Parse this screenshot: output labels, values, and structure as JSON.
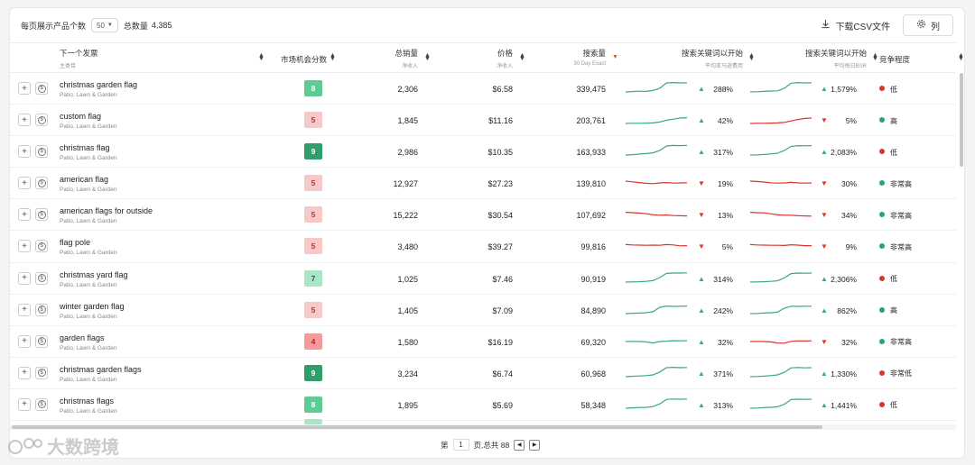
{
  "toolbar": {
    "per_page_label": "每页展示产品个数",
    "per_page_value": "50",
    "total_label": "总数量",
    "total_value": "4,385",
    "csv_label": "下载CSV文件",
    "columns_label": "列"
  },
  "columns": {
    "keyword": {
      "title": "下一个发票",
      "sub": "主类目"
    },
    "score": {
      "title": "市场机会分数"
    },
    "sales": {
      "title": "总销量",
      "sub": "净收入"
    },
    "price": {
      "title": "价格",
      "sub": "净收入"
    },
    "search": {
      "title": "搜索量",
      "sub": "30 Day Exact"
    },
    "trend1": {
      "title": "搜索关键词以开始",
      "sub": "平均亚马逊费用"
    },
    "trend2": {
      "title": "搜索关键词以开始",
      "sub": "平均每日BSR"
    },
    "competition": {
      "title": "竞争程度"
    }
  },
  "colors": {
    "up": "#3aaa78",
    "down": "#d9352b",
    "score_dark_bg": "#2f9e6b",
    "score_mid_bg": "#5ccc94",
    "score_light_bg": "#a8e6c4",
    "score_pink_bg": "#f7c8c8",
    "score_red_bg": "#f49a9a",
    "dot_red": "#d9352b",
    "dot_green": "#2ea36b"
  },
  "rows": [
    {
      "keyword": "christmas garden flag",
      "category": "Patio, Lawn & Garden",
      "score": "8",
      "score_tone": "mid",
      "sales": "2,306",
      "price": "$6.58",
      "search": "339,475",
      "t1_dir": "up",
      "t1_pct": "288%",
      "t1_spark": [
        4,
        4.2,
        4.4,
        4.3,
        4.8,
        6,
        9,
        9.2,
        9,
        9.1
      ],
      "t2_dir": "up",
      "t2_pct": "1,579%",
      "t2_spark": [
        4,
        4.1,
        4.3,
        4.5,
        4.6,
        6,
        8.8,
        9.2,
        9,
        9.1
      ],
      "competition": "低",
      "comp_color": "red"
    },
    {
      "keyword": "custom flag",
      "category": "Patio, Lawn & Garden",
      "score": "5",
      "score_tone": "pink",
      "sales": "1,845",
      "price": "$11.16",
      "search": "203,761",
      "t1_dir": "up",
      "t1_pct": "42%",
      "t1_spark": [
        4,
        4.1,
        4.1,
        4.2,
        4.3,
        4.8,
        5.8,
        6.4,
        7,
        7.2
      ],
      "t2_dir": "down",
      "t2_pct": "5%",
      "t2_spark": [
        4,
        4.1,
        4.1,
        4.2,
        4.3,
        4.6,
        5.4,
        6.2,
        6.8,
        7
      ],
      "competition": "高",
      "comp_color": "green"
    },
    {
      "keyword": "christmas flag",
      "category": "Patio, Lawn & Garden",
      "score": "9",
      "score_tone": "dark",
      "sales": "2,986",
      "price": "$10.35",
      "search": "163,933",
      "t1_dir": "up",
      "t1_pct": "317%",
      "t1_spark": [
        4,
        4.2,
        4.5,
        4.8,
        5.2,
        6.5,
        9,
        9.3,
        9.2,
        9.3
      ],
      "t2_dir": "up",
      "t2_pct": "2,083%",
      "t2_spark": [
        4,
        4.1,
        4.3,
        4.6,
        5,
        6.5,
        8.8,
        9.2,
        9.1,
        9.2
      ],
      "competition": "低",
      "comp_color": "red"
    },
    {
      "keyword": "american flag",
      "category": "Patio, Lawn & Garden",
      "score": "5",
      "score_tone": "pink",
      "sales": "12,927",
      "price": "$27.23",
      "search": "139,810",
      "t1_dir": "down",
      "t1_pct": "19%",
      "t1_spark": [
        7,
        6.6,
        6.2,
        5.8,
        5.6,
        6,
        6.2,
        5.9,
        6,
        6.1
      ],
      "t2_dir": "down",
      "t2_pct": "30%",
      "t2_spark": [
        7,
        6.8,
        6.5,
        6.1,
        5.9,
        6,
        6.3,
        6,
        5.9,
        6
      ],
      "competition": "非常高",
      "comp_color": "green"
    },
    {
      "keyword": "american flags for outside",
      "category": "Patio, Lawn & Garden",
      "score": "5",
      "score_tone": "pink",
      "sales": "15,222",
      "price": "$30.54",
      "search": "107,692",
      "t1_dir": "down",
      "t1_pct": "13%",
      "t1_spark": [
        7.2,
        7,
        6.8,
        6.4,
        5.8,
        5.6,
        5.7,
        5.4,
        5.3,
        5.2
      ],
      "t2_dir": "down",
      "t2_pct": "34%",
      "t2_spark": [
        7.2,
        7,
        6.9,
        6.4,
        5.8,
        5.6,
        5.6,
        5.3,
        5.2,
        5.1
      ],
      "competition": "非常高",
      "comp_color": "green"
    },
    {
      "keyword": "flag pole",
      "category": "Patio, Lawn & Garden",
      "score": "5",
      "score_tone": "pink",
      "sales": "3,480",
      "price": "$39.27",
      "search": "99,816",
      "t1_dir": "down",
      "t1_pct": "5%",
      "t1_spark": [
        6.8,
        6.6,
        6.5,
        6.4,
        6.5,
        6.4,
        6.8,
        6.6,
        6.1,
        6.2
      ],
      "t2_dir": "down",
      "t2_pct": "9%",
      "t2_spark": [
        6.8,
        6.6,
        6.5,
        6.4,
        6.4,
        6.3,
        6.7,
        6.5,
        6.2,
        6.2
      ],
      "competition": "非常高",
      "comp_color": "green"
    },
    {
      "keyword": "christmas yard flag",
      "category": "Patio, Lawn & Garden",
      "score": "7",
      "score_tone": "light",
      "sales": "1,025",
      "price": "$7.46",
      "search": "90,919",
      "t1_dir": "up",
      "t1_pct": "314%",
      "t1_spark": [
        4,
        4.1,
        4.2,
        4.4,
        4.8,
        6.5,
        8.8,
        9,
        9,
        9.1
      ],
      "t2_dir": "up",
      "t2_pct": "2,306%",
      "t2_spark": [
        4,
        4.1,
        4.2,
        4.4,
        4.7,
        6.3,
        8.7,
        9,
        8.9,
        9
      ],
      "competition": "低",
      "comp_color": "red"
    },
    {
      "keyword": "winter garden flag",
      "category": "Patio, Lawn & Garden",
      "score": "5",
      "score_tone": "pink",
      "sales": "1,405",
      "price": "$7.09",
      "search": "84,890",
      "t1_dir": "up",
      "t1_pct": "242%",
      "t1_spark": [
        4,
        4.2,
        4.3,
        4.5,
        5,
        7.5,
        8.2,
        8,
        8.1,
        8.2
      ],
      "t2_dir": "up",
      "t2_pct": "862%",
      "t2_spark": [
        4,
        4.1,
        4.3,
        4.5,
        4.8,
        7,
        8.1,
        8,
        8.1,
        8.1
      ],
      "competition": "高",
      "comp_color": "green"
    },
    {
      "keyword": "garden flags",
      "category": "Patio, Lawn & Garden",
      "score": "4",
      "score_tone": "red",
      "sales": "1,580",
      "price": "$16.19",
      "search": "69,320",
      "t1_dir": "up",
      "t1_pct": "32%",
      "t1_spark": [
        6,
        6.1,
        6,
        5.8,
        5.2,
        6,
        6.2,
        6.5,
        6.4,
        6.5
      ],
      "t2_dir": "down",
      "t2_pct": "32%",
      "t2_spark": [
        6,
        6.1,
        6,
        5.8,
        5.2,
        5.1,
        6.1,
        6.4,
        6.3,
        6.4
      ],
      "competition": "非常高",
      "comp_color": "green"
    },
    {
      "keyword": "christmas garden flags",
      "category": "Patio, Lawn & Garden",
      "score": "9",
      "score_tone": "dark",
      "sales": "3,234",
      "price": "$6.74",
      "search": "60,968",
      "t1_dir": "up",
      "t1_pct": "371%",
      "t1_spark": [
        4,
        4.2,
        4.4,
        4.6,
        5,
        6.6,
        9,
        9.2,
        9,
        9.1
      ],
      "t2_dir": "up",
      "t2_pct": "1,330%",
      "t2_spark": [
        4,
        4.1,
        4.3,
        4.6,
        5,
        6.4,
        8.9,
        9.1,
        8.9,
        9
      ],
      "competition": "非常低",
      "comp_color": "red"
    },
    {
      "keyword": "christmas flags",
      "category": "Patio, Lawn & Garden",
      "score": "8",
      "score_tone": "mid",
      "sales": "1,895",
      "price": "$5.69",
      "search": "58,348",
      "t1_dir": "up",
      "t1_pct": "313%",
      "t1_spark": [
        4,
        4.2,
        4.4,
        4.5,
        4.9,
        6.4,
        8.9,
        9.1,
        9,
        9.1
      ],
      "t2_dir": "up",
      "t2_pct": "1,441%",
      "t2_spark": [
        4,
        4.1,
        4.3,
        4.5,
        4.8,
        6.2,
        8.8,
        9,
        8.9,
        9
      ],
      "competition": "低",
      "comp_color": "red"
    }
  ],
  "pager": {
    "prefix": "第",
    "current": "1",
    "suffix": "页,总共 88"
  },
  "watermark": "大数跨境"
}
